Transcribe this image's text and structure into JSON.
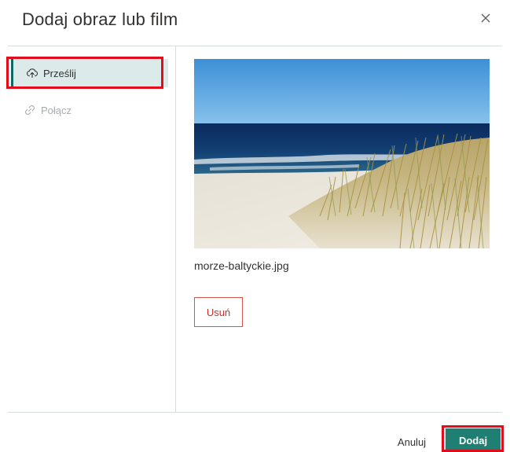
{
  "dialog": {
    "title": "Dodaj obraz lub film"
  },
  "nav": {
    "items": [
      {
        "label": "Prześlij",
        "icon": "upload-icon",
        "selected": true
      },
      {
        "label": "Połącz",
        "icon": "link-icon",
        "selected": false
      }
    ]
  },
  "preview": {
    "filename": "morze-baltyckie.jpg",
    "remove_label": "Usuń"
  },
  "footer": {
    "cancel_label": "Anuluj",
    "add_label": "Dodaj"
  },
  "colors": {
    "accent": "#1e7f72",
    "selected_nav_bg": "#dcebea",
    "highlight": "#e20d1c",
    "remove": "#d9534f"
  }
}
